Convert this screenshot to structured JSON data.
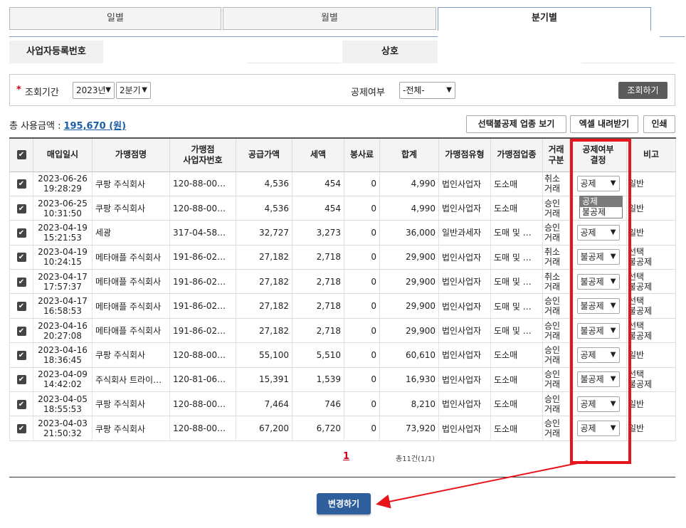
{
  "tabs": [
    {
      "label": "일별",
      "active": false
    },
    {
      "label": "월별",
      "active": false
    },
    {
      "label": "분기별",
      "active": true
    }
  ],
  "info": {
    "business_reg_label": "사업자등록번호",
    "business_reg_value": "",
    "company_label": "상호",
    "company_value": ""
  },
  "search": {
    "period_label": "조회기간",
    "year_value": "2023년",
    "quarter_value": "2분기",
    "deduction_label": "공제여부",
    "deduction_value": "-전체-",
    "search_button": "조회하기"
  },
  "summary": {
    "total_label": "총 사용금액 :",
    "total_amount": "195,670 (원)"
  },
  "actions": {
    "view_non_deduct": "선택불공제 업종 보기",
    "excel_download": "엑셀 내려받기",
    "print": "인쇄"
  },
  "table": {
    "headers": {
      "purchase_date": "매입일시",
      "merchant": "가맹점명",
      "merchant_reg_1": "가맹점",
      "merchant_reg_2": "사업자번호",
      "supply": "공급가액",
      "tax": "세액",
      "service": "봉사료",
      "total": "합계",
      "merchant_type": "가맹점유형",
      "merchant_industry": "가맹점업종",
      "txn_type_1": "거래",
      "txn_type_2": "구분",
      "deduct_1": "공제여부",
      "deduct_2": "결정",
      "note": "비고"
    },
    "rows": [
      {
        "date": "2023-06-26",
        "time": "19:28:29",
        "merchant": "쿠팡 주식회사",
        "reg": "120-88-00…",
        "supply": "4,536",
        "tax": "454",
        "service": "0",
        "total": "4,990",
        "type": "법인사업자",
        "industry": "도소매",
        "txn": "취소",
        "txn2": "거래",
        "deduct": "공제",
        "note": "일반",
        "note2": ""
      },
      {
        "date": "2023-06-25",
        "time": "10:31:50",
        "merchant": "쿠팡 주식회사",
        "reg": "120-88-00…",
        "supply": "4,536",
        "tax": "454",
        "service": "0",
        "total": "4,990",
        "type": "법인사업자",
        "industry": "도소매",
        "txn": "승인",
        "txn2": "거래",
        "deduct": "",
        "note": "일반",
        "note2": ""
      },
      {
        "date": "2023-04-19",
        "time": "15:21:53",
        "merchant": "세광",
        "reg": "317-04-58…",
        "supply": "32,727",
        "tax": "3,273",
        "service": "0",
        "total": "36,000",
        "type": "일반과세자",
        "industry": "도매 및 …",
        "txn": "승인",
        "txn2": "거래",
        "deduct": "공제",
        "note": "일반",
        "note2": ""
      },
      {
        "date": "2023-04-19",
        "time": "10:24:15",
        "merchant": "메타애플 주식회사",
        "reg": "191-86-02…",
        "supply": "27,182",
        "tax": "2,718",
        "service": "0",
        "total": "29,900",
        "type": "법인사업자",
        "industry": "도매 및 …",
        "txn": "취소",
        "txn2": "거래",
        "deduct": "불공제",
        "note": "선택",
        "note2": "불공제"
      },
      {
        "date": "2023-04-17",
        "time": "17:57:37",
        "merchant": "메타애플 주식회사",
        "reg": "191-86-02…",
        "supply": "27,182",
        "tax": "2,718",
        "service": "0",
        "total": "29,900",
        "type": "법인사업자",
        "industry": "도매 및 …",
        "txn": "취소",
        "txn2": "거래",
        "deduct": "불공제",
        "note": "선택",
        "note2": "불공제"
      },
      {
        "date": "2023-04-17",
        "time": "16:58:53",
        "merchant": "메타애플 주식회사",
        "reg": "191-86-02…",
        "supply": "27,182",
        "tax": "2,718",
        "service": "0",
        "total": "29,900",
        "type": "법인사업자",
        "industry": "도매 및 …",
        "txn": "승인",
        "txn2": "거래",
        "deduct": "불공제",
        "note": "선택",
        "note2": "불공제"
      },
      {
        "date": "2023-04-16",
        "time": "20:27:08",
        "merchant": "메타애플 주식회사",
        "reg": "191-86-02…",
        "supply": "27,182",
        "tax": "2,718",
        "service": "0",
        "total": "29,900",
        "type": "법인사업자",
        "industry": "도매 및 …",
        "txn": "승인",
        "txn2": "거래",
        "deduct": "불공제",
        "note": "선택",
        "note2": "불공제"
      },
      {
        "date": "2023-04-16",
        "time": "18:36:45",
        "merchant": "쿠팡 주식회사",
        "reg": "120-88-00…",
        "supply": "55,100",
        "tax": "5,510",
        "service": "0",
        "total": "60,610",
        "type": "법인사업자",
        "industry": "도소매",
        "txn": "승인",
        "txn2": "거래",
        "deduct": "공제",
        "note": "일반",
        "note2": ""
      },
      {
        "date": "2023-04-09",
        "time": "14:42:02",
        "merchant": "주식회사 트라이…",
        "reg": "120-81-06…",
        "supply": "15,391",
        "tax": "1,539",
        "service": "0",
        "total": "16,930",
        "type": "법인사업자",
        "industry": "도소매",
        "txn": "승인",
        "txn2": "거래",
        "deduct": "불공제",
        "note": "선택",
        "note2": "불공제"
      },
      {
        "date": "2023-04-05",
        "time": "18:55:53",
        "merchant": "쿠팡 주식회사",
        "reg": "120-88-00…",
        "supply": "7,464",
        "tax": "746",
        "service": "0",
        "total": "8,210",
        "type": "법인사업자",
        "industry": "도소매",
        "txn": "승인",
        "txn2": "거래",
        "deduct": "공제",
        "note": "일반",
        "note2": ""
      },
      {
        "date": "2023-04-03",
        "time": "21:50:32",
        "merchant": "쿠팡 주식회사",
        "reg": "120-88-00…",
        "supply": "67,200",
        "tax": "6,720",
        "service": "0",
        "total": "73,920",
        "type": "법인사업자",
        "industry": "도소매",
        "txn": "승인",
        "txn2": "거래",
        "deduct": "공제",
        "note": "일반",
        "note2": ""
      }
    ]
  },
  "dropdown_options": [
    "공제",
    "불공제"
  ],
  "pagination": {
    "current": "1",
    "total_text": "총11건(1/1)"
  },
  "save_button": "변경하기",
  "colors": {
    "highlight": "#e8141b",
    "primary": "#2f5e9c",
    "link": "#1a5ea8"
  }
}
